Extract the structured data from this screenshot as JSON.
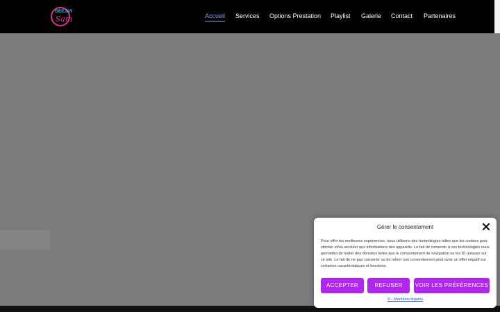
{
  "logo": {
    "line1": "DEEJAY",
    "line2": "Sam",
    "ring_color": "#e0308a",
    "text_color": "#35c8f0"
  },
  "nav": {
    "items": [
      {
        "label": "Accueil",
        "active": true
      },
      {
        "label": "Services"
      },
      {
        "label": "Options Prestation"
      },
      {
        "label": "Playlist"
      },
      {
        "label": "Galerie"
      },
      {
        "label": "Contact"
      },
      {
        "label": "Partenaires"
      }
    ]
  },
  "consent": {
    "title": "Gérer le consentement",
    "close_icon": "close-icon",
    "body": "Pour offrir les meilleures expériences, nous utilisons des technologies telles que les cookies pour stocker et/ou accéder aux informations des appareils. Le fait de consentir à ces technologies nous permettra de traiter des données telles que le comportement de navigation ou les ID uniques sur ce site. Le fait de ne pas consentir ou de retirer son consentement peut avoir un effet négatif sur certaines caractéristiques et fonctions.",
    "accept_label": "ACCEPTER",
    "refuse_label": "REFUSER",
    "prefs_label": "VOIR LES PRÉFÉRENCES",
    "legal_link": "9 – Mentions légales",
    "button_color": "#b224ef"
  },
  "colors": {
    "nav_active": "#7ea6e6",
    "hero_overlay": "#7c7c7c",
    "header_bg": "#000000"
  }
}
